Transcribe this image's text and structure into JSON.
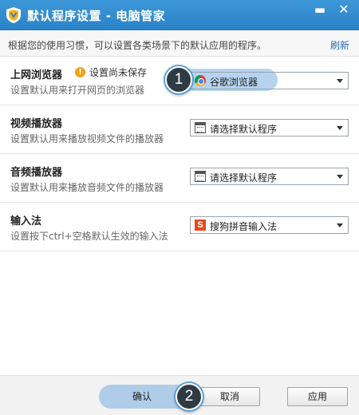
{
  "window": {
    "title": "默认程序设置 - 电脑管家",
    "minimize_glyph": "▬",
    "close_glyph": "✕",
    "logo_icon": "shield-logo-icon",
    "accent": "#2f88cd"
  },
  "hint": {
    "text": "根据您的使用习惯，可以设置各类场景下的默认应用的程序。",
    "refresh_label": "刷新"
  },
  "rows": [
    {
      "title": "上网浏览器",
      "desc": "设置默认用来打开网页的浏览器",
      "warning": "设置尚未保存",
      "warning_glyph": "!",
      "select_value": "谷歌浏览器",
      "select_icon": "chrome-icon"
    },
    {
      "title": "视频播放器",
      "desc": "设置默认用来播放视频文件的播放器",
      "select_value": "请选择默认程序",
      "select_icon": "app-window-icon"
    },
    {
      "title": "音频播放器",
      "desc": "设置默认用来播放音频文件的播放器",
      "select_value": "请选择默认程序",
      "select_icon": "app-window-icon"
    },
    {
      "title": "输入法",
      "desc": "设置按下ctrl+空格默认生效的输入法",
      "select_value": "搜狗拼音输入法",
      "select_icon": "sogou-icon",
      "select_icon_glyph": "S"
    }
  ],
  "markers": {
    "step1": "1",
    "step2": "2"
  },
  "footer": {
    "ok_label": "确认",
    "cancel_label": "取消",
    "apply_label": "应用"
  }
}
